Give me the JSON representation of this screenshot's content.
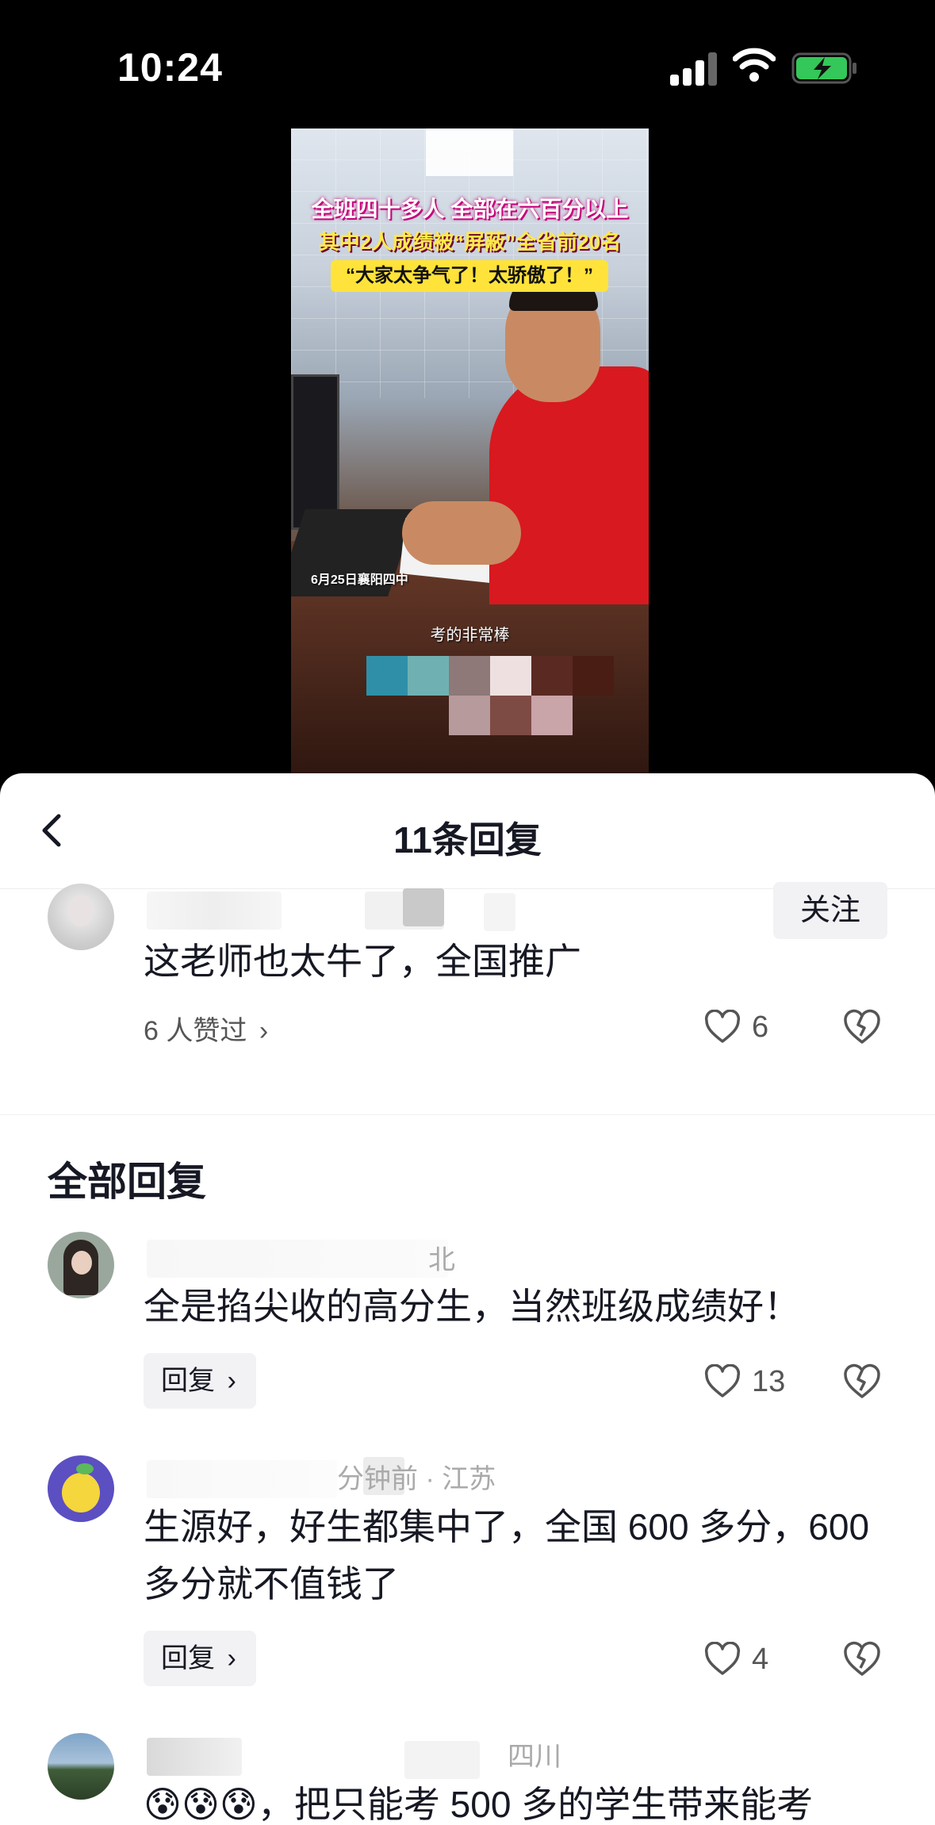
{
  "status_bar": {
    "time": "10:24"
  },
  "video": {
    "caption_line1": "全班四十多人 全部在六百分以上",
    "caption_line2": "其中2人成绩被“屏蔽”全省前20名",
    "caption_line3": "“大家太争气了！太骄傲了！”",
    "date_tag": "6月25日襄阳四中",
    "subtitle": "考的非常棒"
  },
  "panel": {
    "title": "11条回复",
    "main_comment": {
      "follow_label": "关注",
      "text": "这老师也太牛了，全国推广",
      "liked_by": "6 人赞过",
      "like_count": "6"
    },
    "section_title": "全部回复",
    "replies": [
      {
        "meta": "北",
        "text": "全是掐尖收的高分生，当然班级成绩好！",
        "reply_label": "回复",
        "like_count": "13"
      },
      {
        "meta": "分钟前 · 江苏",
        "text_line1": "生源好，好生都集中了，全国 600 多分，600",
        "text_line2": "多分就不值钱了",
        "reply_label": "回复",
        "like_count": "4"
      },
      {
        "meta": "四川",
        "emojis": "😰😰😰",
        "text": "，把只能考 500 多的学生带来能考"
      }
    ]
  },
  "colors": {
    "background": "#000000",
    "panel": "#ffffff",
    "text": "#161823",
    "muted": "#555555",
    "video_red": "#d8191f"
  }
}
